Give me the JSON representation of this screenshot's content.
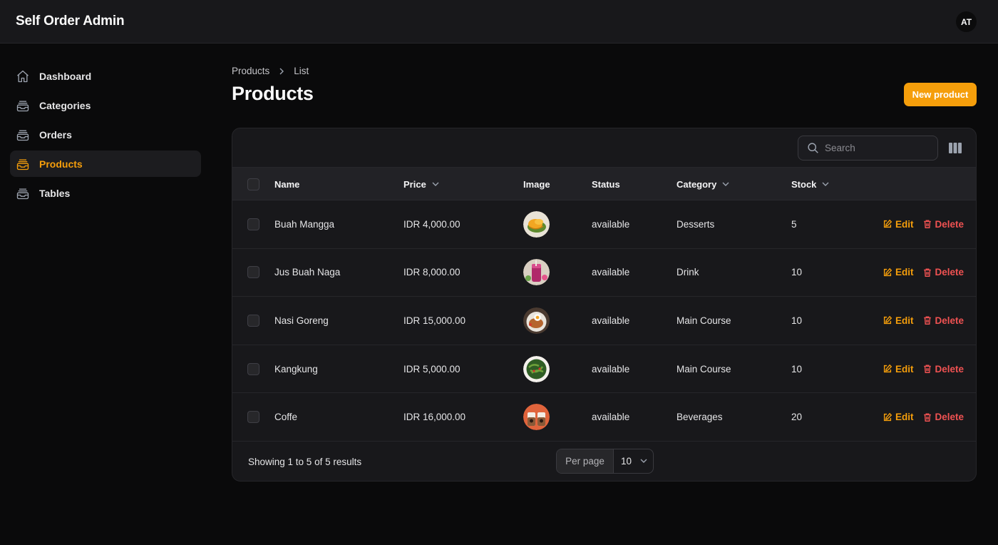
{
  "app": {
    "title": "Self Order Admin",
    "avatar_initials": "AT"
  },
  "sidebar": {
    "items": [
      {
        "label": "Dashboard",
        "icon": "home-icon",
        "active": false
      },
      {
        "label": "Categories",
        "icon": "inbox-stack-icon",
        "active": false
      },
      {
        "label": "Orders",
        "icon": "inbox-stack-icon",
        "active": false
      },
      {
        "label": "Products",
        "icon": "inbox-stack-icon",
        "active": true
      },
      {
        "label": "Tables",
        "icon": "inbox-stack-icon",
        "active": false
      }
    ]
  },
  "breadcrumb": {
    "parent": "Products",
    "current": "List"
  },
  "page": {
    "title": "Products",
    "new_button": "New product"
  },
  "toolbar": {
    "search_placeholder": "Search"
  },
  "table": {
    "headers": {
      "name": "Name",
      "price": "Price",
      "image": "Image",
      "status": "Status",
      "category": "Category",
      "stock": "Stock"
    },
    "rows": [
      {
        "name": "Buah Mangga",
        "price": "IDR 4,000.00",
        "status": "available",
        "category": "Desserts",
        "stock": "5",
        "image": "mango-thumbnail"
      },
      {
        "name": "Jus Buah Naga",
        "price": "IDR 8,000.00",
        "status": "available",
        "category": "Drink",
        "stock": "10",
        "image": "dragonfruit-juice-thumbnail"
      },
      {
        "name": "Nasi Goreng",
        "price": "IDR 15,000.00",
        "status": "available",
        "category": "Main Course",
        "stock": "10",
        "image": "fried-rice-thumbnail"
      },
      {
        "name": "Kangkung",
        "price": "IDR 5,000.00",
        "status": "available",
        "category": "Main Course",
        "stock": "10",
        "image": "water-spinach-thumbnail"
      },
      {
        "name": "Coffe",
        "price": "IDR 16,000.00",
        "status": "available",
        "category": "Beverages",
        "stock": "20",
        "image": "coffee-thumbnail"
      }
    ],
    "actions": {
      "edit": "Edit",
      "delete": "Delete"
    }
  },
  "footer": {
    "showing": "Showing 1 to 5 of 5 results",
    "per_page_label": "Per page",
    "per_page_value": "10"
  },
  "colors": {
    "accent": "#f59e0b",
    "danger": "#f05252",
    "background": "#0a0a0b",
    "surface": "#18181b"
  }
}
